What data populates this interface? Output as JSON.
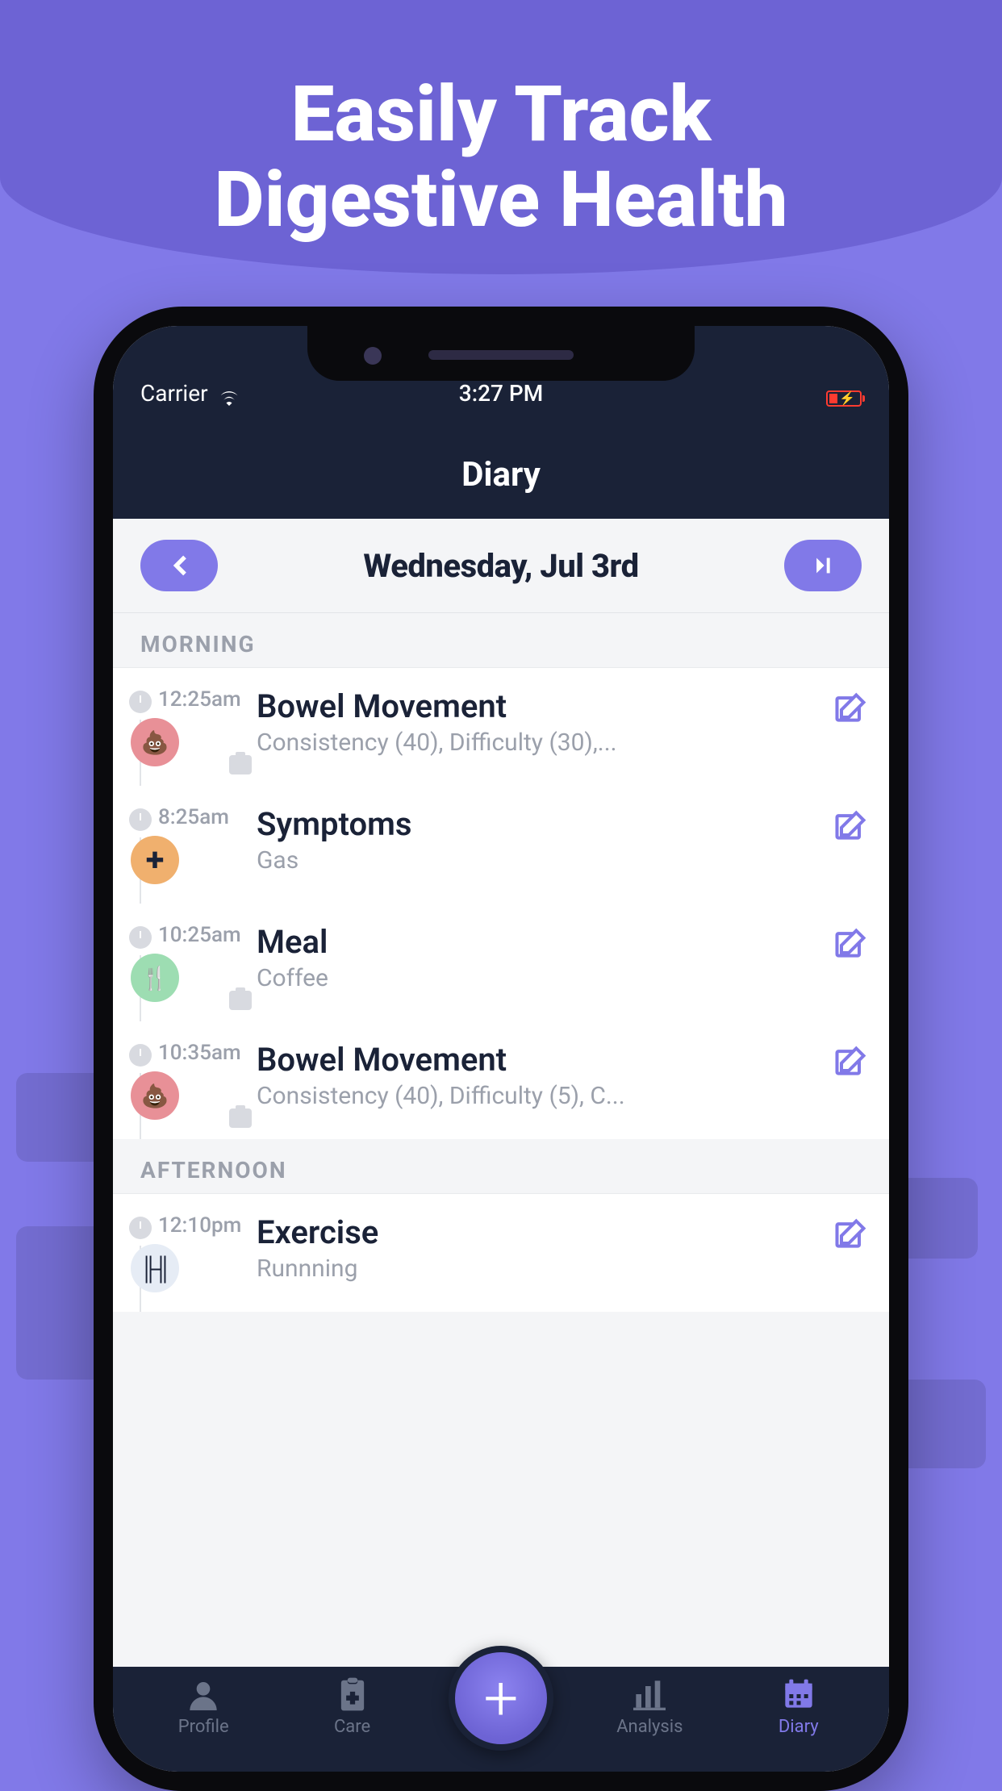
{
  "marketing": {
    "title_line1": "Easily Track",
    "title_line2": "Digestive Health"
  },
  "status": {
    "carrier": "Carrier",
    "time": "3:27 PM"
  },
  "header": {
    "title": "Diary"
  },
  "date_nav": {
    "date": "Wednesday, Jul 3rd"
  },
  "sections": [
    {
      "label": "MORNING",
      "entries": [
        {
          "time": "12:25am",
          "icon": "bm",
          "has_camera": true,
          "title": "Bowel Movement",
          "subtitle": "Consistency (40), Difficulty (30),..."
        },
        {
          "time": "8:25am",
          "icon": "symptoms",
          "has_camera": false,
          "title": "Symptoms",
          "subtitle": "Gas"
        },
        {
          "time": "10:25am",
          "icon": "meal",
          "has_camera": true,
          "title": "Meal",
          "subtitle": "Coffee"
        },
        {
          "time": "10:35am",
          "icon": "bm",
          "has_camera": true,
          "title": "Bowel Movement",
          "subtitle": "Consistency (40), Difficulty (5), C..."
        }
      ]
    },
    {
      "label": "AFTERNOON",
      "entries": [
        {
          "time": "12:10pm",
          "icon": "exercise",
          "has_camera": false,
          "title": "Exercise",
          "subtitle": "Runnning"
        }
      ]
    }
  ],
  "icon_glyphs": {
    "bm": "💩",
    "symptoms": "✚",
    "meal": "🍴",
    "exercise": "╟╢"
  },
  "tabs": [
    {
      "id": "profile",
      "label": "Profile",
      "active": false
    },
    {
      "id": "care",
      "label": "Care",
      "active": false
    },
    {
      "id": "analysis",
      "label": "Analysis",
      "active": false
    },
    {
      "id": "diary",
      "label": "Diary",
      "active": true
    }
  ]
}
